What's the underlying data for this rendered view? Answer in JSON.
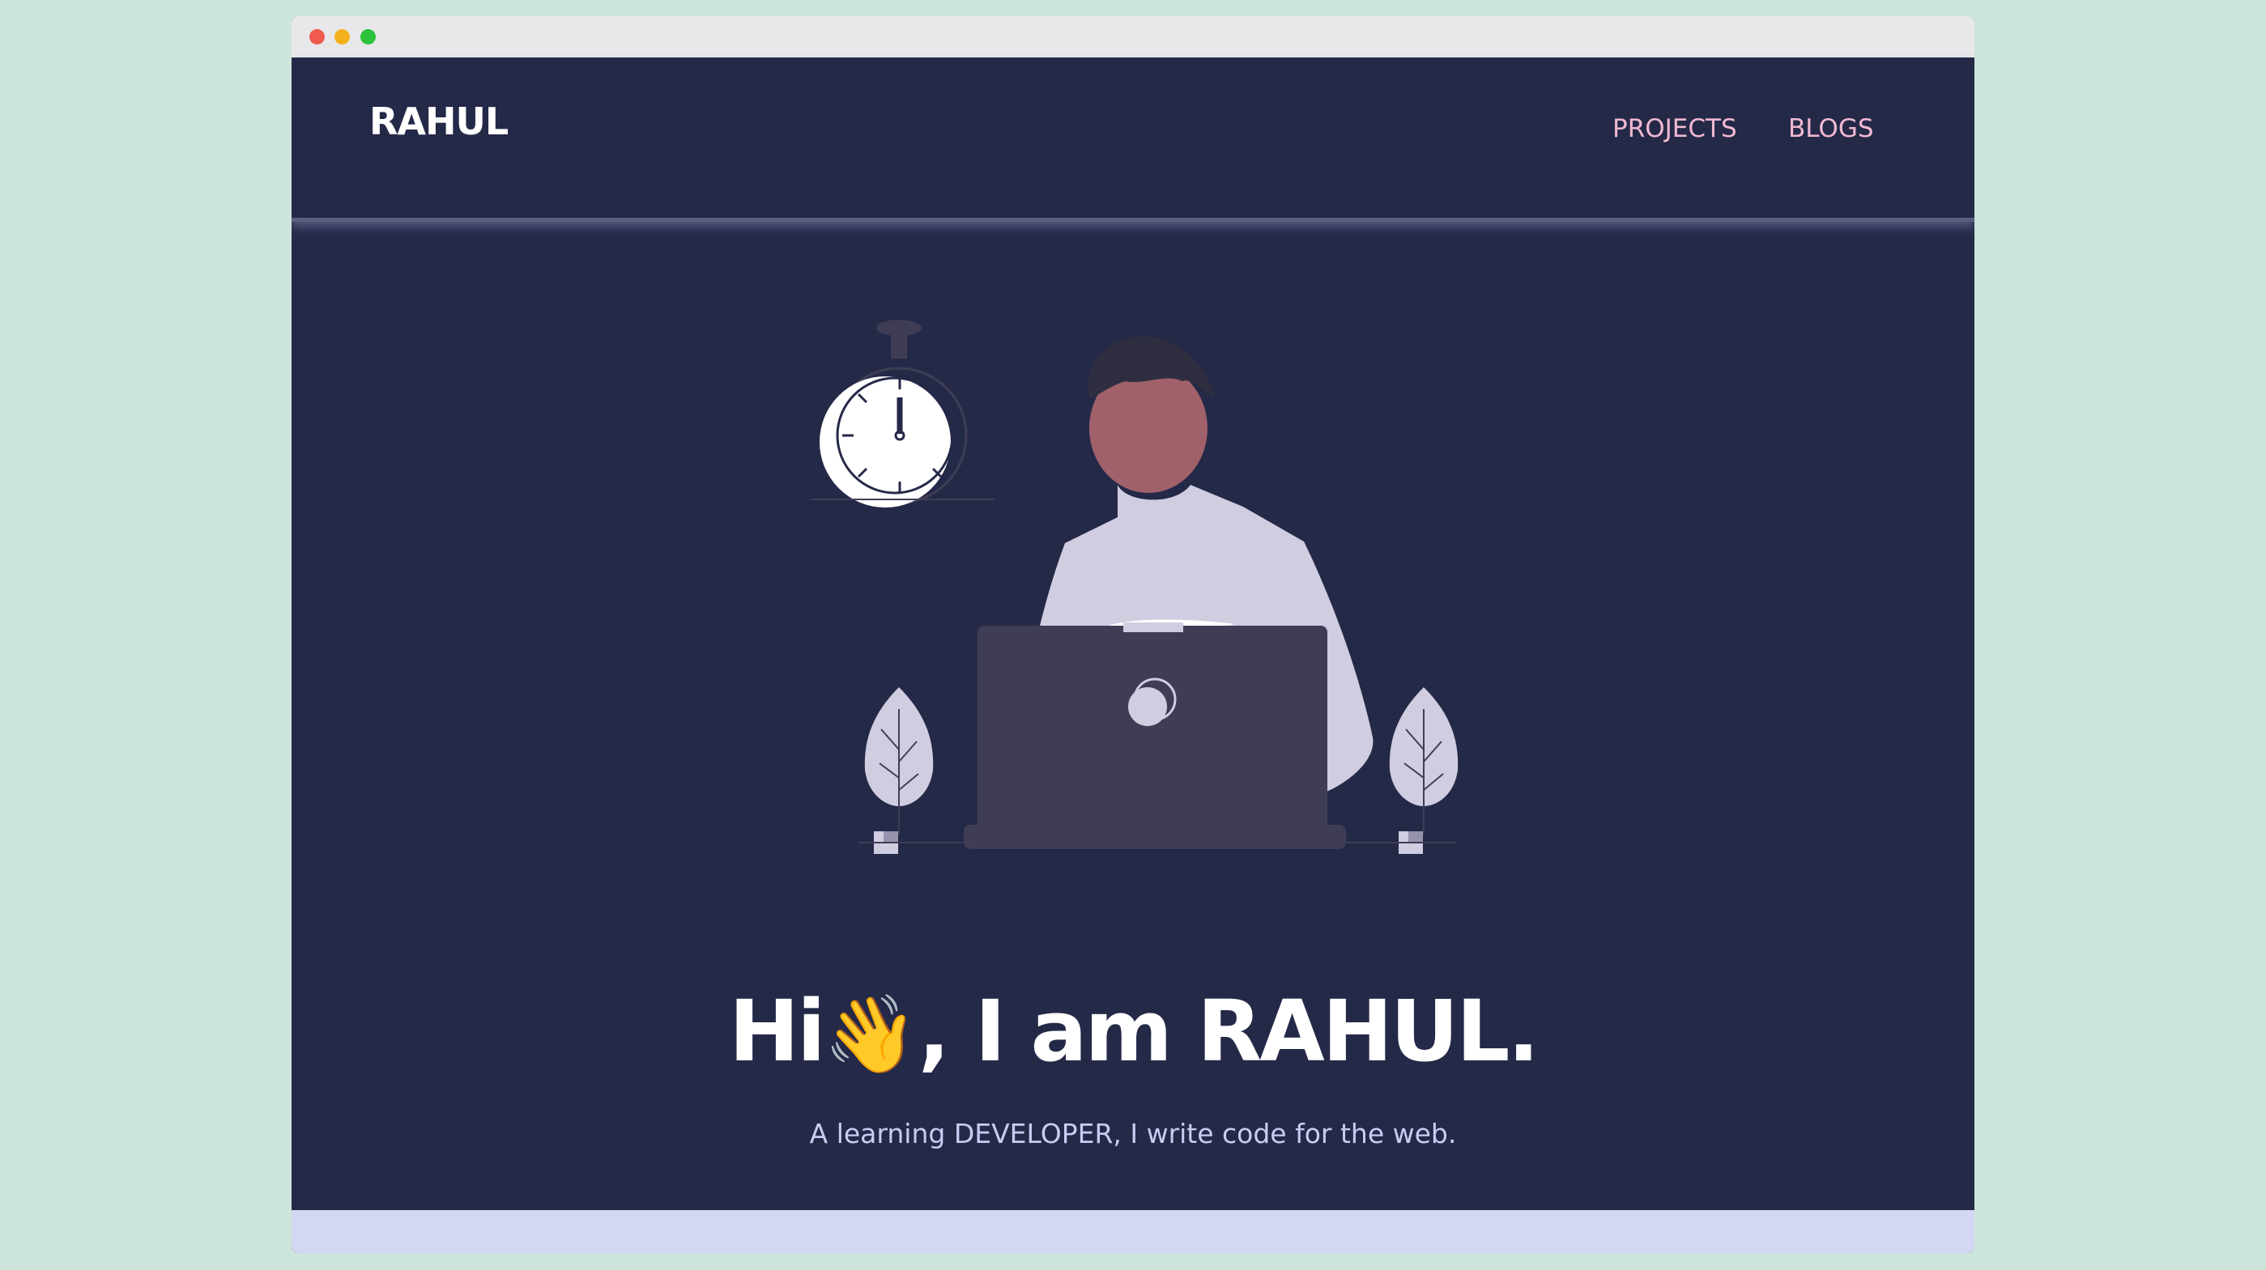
{
  "header": {
    "logo_text": "RAHUL",
    "nav": [
      {
        "label": "PROJECTS"
      },
      {
        "label": "BLOGS"
      }
    ]
  },
  "hero": {
    "title_prefix": "Hi",
    "emoji": "👋",
    "title_suffix": ", I am RAHUL.",
    "subtitle": "A learning DEVELOPER, I write code for the web."
  },
  "colors": {
    "background": "#cde5db",
    "page_bg": "#252948",
    "nav_link": "#efb9d1",
    "subtitle": "#c9cbf2",
    "footer_strip": "#d3d7f2"
  },
  "icons": [
    "stopwatch-icon",
    "plant-icon",
    "laptop-icon",
    "person-illustration",
    "wave-emoji"
  ]
}
